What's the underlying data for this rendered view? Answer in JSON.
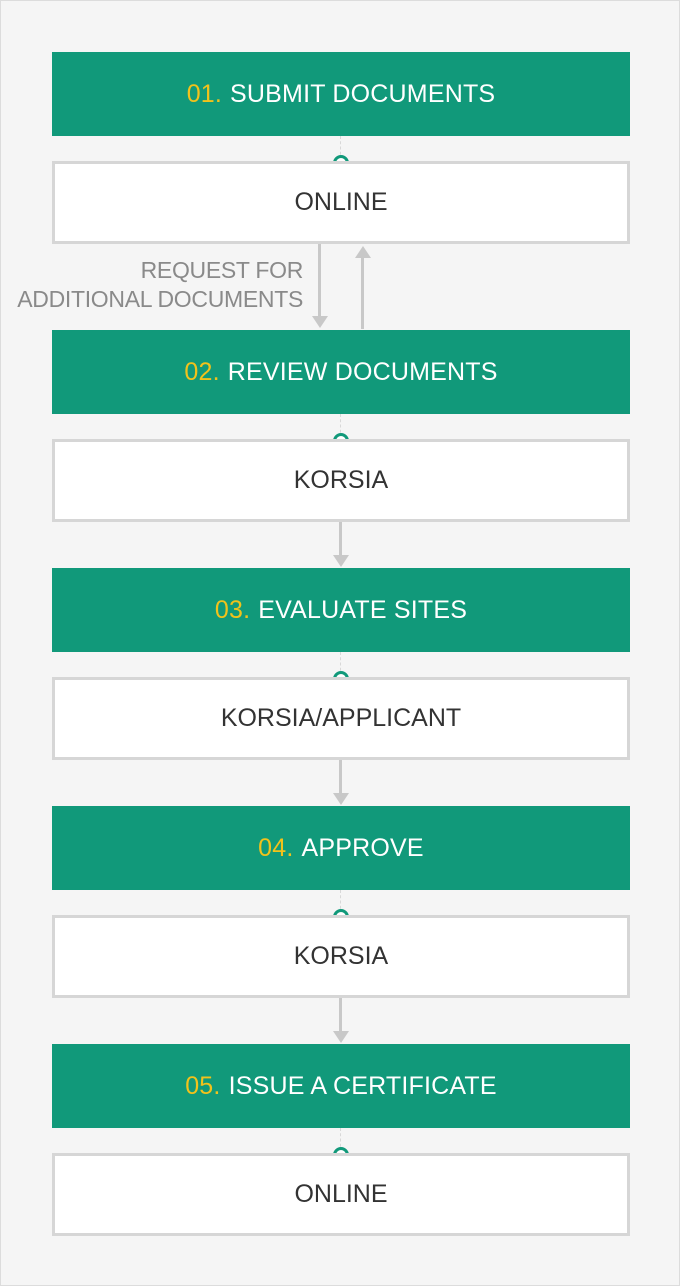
{
  "steps": [
    {
      "number": "01.",
      "title": "SUBMIT DOCUMENTS",
      "responsible": "ONLINE"
    },
    {
      "number": "02.",
      "title": "REVIEW DOCUMENTS",
      "responsible": "KORSIA"
    },
    {
      "number": "03.",
      "title": "EVALUATE SITES",
      "responsible": "KORSIA/APPLICANT"
    },
    {
      "number": "04.",
      "title": "APPROVE",
      "responsible": "KORSIA"
    },
    {
      "number": "05.",
      "title": "ISSUE A CERTIFICATE",
      "responsible": "ONLINE"
    }
  ],
  "loop_label": {
    "line1": "REQUEST FOR",
    "line2": "ADDITIONAL DOCUMENTS"
  },
  "colors": {
    "step_fill": "#11997a",
    "step_number": "#f2c21b",
    "arrow": "#c8c8c8",
    "sub_border": "#d6d6d6"
  }
}
